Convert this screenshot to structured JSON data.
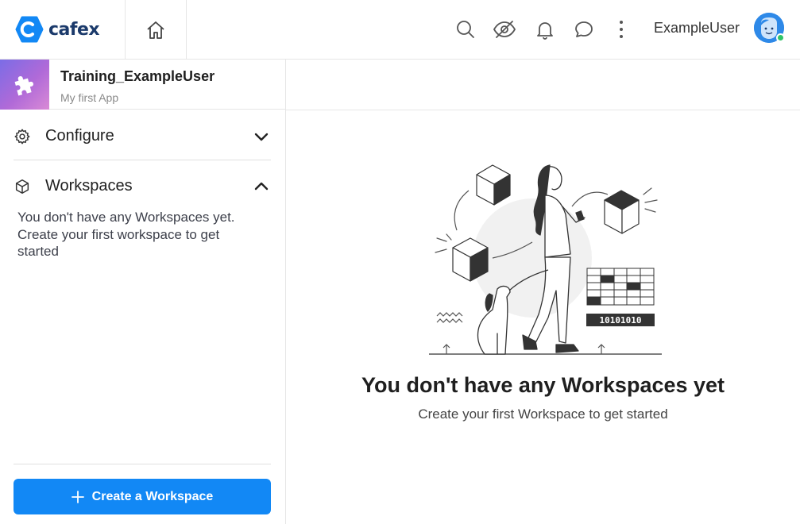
{
  "brand": {
    "name": "cafex"
  },
  "topbar": {
    "username": "ExampleUser",
    "icons": [
      "home-icon",
      "search-icon",
      "eye-off-icon",
      "bell-icon",
      "chat-icon",
      "more-vertical-icon"
    ]
  },
  "app": {
    "name": "Training_ExampleUser",
    "subtitle": "My first App",
    "icon": "puzzle-icon"
  },
  "sidebar": {
    "configure_label": "Configure",
    "workspaces_label": "Workspaces",
    "empty_text": "You don't have any Workspaces yet. Create your first workspace to get started",
    "create_button": "Create a Workspace"
  },
  "main": {
    "empty_title": "You don't have any Workspaces yet",
    "empty_subtitle": "Create your first Workspace to get started",
    "illustration_code": "10101010"
  },
  "colors": {
    "accent": "#1288f5",
    "status_online": "#2fc468",
    "avatar": "#2e89e8"
  }
}
